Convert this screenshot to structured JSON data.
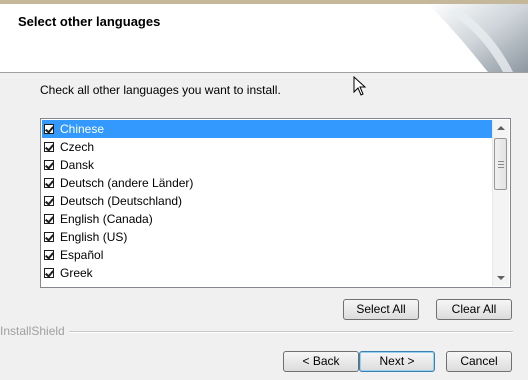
{
  "header": {
    "title": "Select other languages"
  },
  "instruction": "Check all other languages you want to install.",
  "languages": [
    {
      "label": "Chinese",
      "checked": true,
      "selected": true
    },
    {
      "label": "Czech",
      "checked": true
    },
    {
      "label": "Dansk",
      "checked": true
    },
    {
      "label": "Deutsch (andere Länder)",
      "checked": true
    },
    {
      "label": "Deutsch (Deutschland)",
      "checked": true
    },
    {
      "label": "English (Canada)",
      "checked": true
    },
    {
      "label": "English (US)",
      "checked": true
    },
    {
      "label": "Español",
      "checked": true
    },
    {
      "label": "Greek",
      "checked": true
    }
  ],
  "buttons": {
    "select_all": "Select All",
    "clear_all": "Clear All",
    "back": "< Back",
    "next": "Next >",
    "cancel": "Cancel"
  },
  "brand": "InstallShield",
  "colors": {
    "selection": "#3399ff",
    "header_bg": "#ffffff",
    "dialog_bg": "#f0f0f0"
  }
}
